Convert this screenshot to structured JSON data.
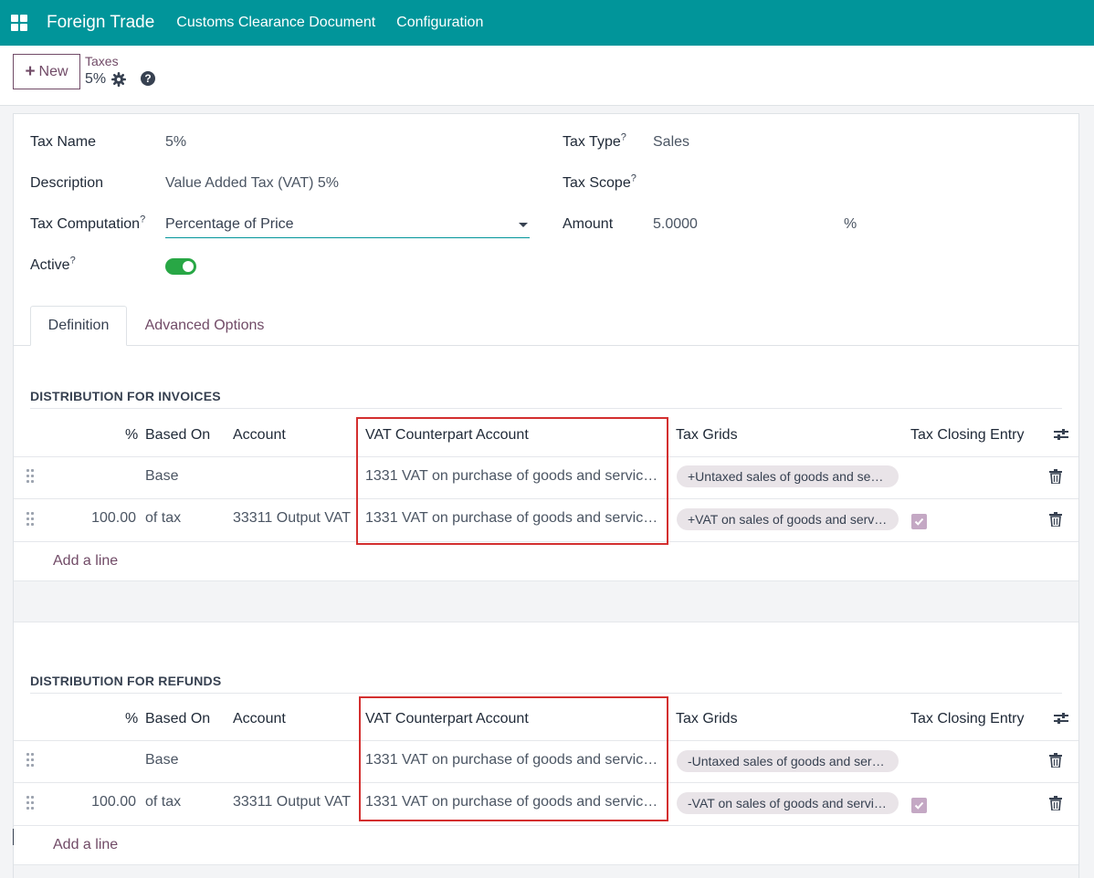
{
  "navbar": {
    "brand": "Foreign Trade",
    "menu": [
      "Customs Clearance Document",
      "Configuration"
    ],
    "bg_color": "#01959a"
  },
  "control_panel": {
    "new_label": "New",
    "breadcrumb_parent": "Taxes",
    "breadcrumb_current": "5%",
    "accent_color": "#714b67"
  },
  "form": {
    "tax_name_label": "Tax Name",
    "tax_name_value": "5%",
    "description_label": "Description",
    "description_value": "Value Added Tax (VAT) 5%",
    "tax_computation_label": "Tax Computation",
    "tax_computation_value": "Percentage of Price",
    "active_label": "Active",
    "active_value": true,
    "tax_type_label": "Tax Type",
    "tax_type_value": "Sales",
    "tax_scope_label": "Tax Scope",
    "tax_scope_value": "",
    "amount_label": "Amount",
    "amount_value": "5.0000",
    "amount_unit": "%",
    "help_mark": "?"
  },
  "tabs": [
    "Definition",
    "Advanced Options"
  ],
  "columns": {
    "percent": "%",
    "based_on": "Based On",
    "account": "Account",
    "vat_counterpart": "VAT Counterpart Account",
    "tax_grids": "Tax Grids",
    "tax_closing": "Tax Closing Entry"
  },
  "invoices": {
    "title": "DISTRIBUTION FOR INVOICES",
    "rows": [
      {
        "percent": "",
        "based_on": "Base",
        "account": "",
        "vat_counterpart": "1331 VAT on purchase of goods and servic…",
        "tax_grid": "+Untaxed sales of goods and ser…",
        "closing": false
      },
      {
        "percent": "100.00",
        "based_on": "of tax",
        "account": "33311 Output VAT",
        "vat_counterpart": "1331 VAT on purchase of goods and servic…",
        "tax_grid": "+VAT on sales of goods and serv…",
        "closing": true
      }
    ],
    "add_line": "Add a line"
  },
  "refunds": {
    "title": "DISTRIBUTION FOR REFUNDS",
    "rows": [
      {
        "percent": "",
        "based_on": "Base",
        "account": "",
        "vat_counterpart": "1331 VAT on purchase of goods and servic…",
        "tax_grid": "-Untaxed sales of goods and ser…",
        "closing": false
      },
      {
        "percent": "100.00",
        "based_on": "of tax",
        "account": "33311 Output VAT",
        "vat_counterpart": "1331 VAT on purchase of goods and servic…",
        "tax_grid": "-VAT on sales of goods and servi…",
        "closing": true
      }
    ],
    "add_line": "Add a line"
  }
}
